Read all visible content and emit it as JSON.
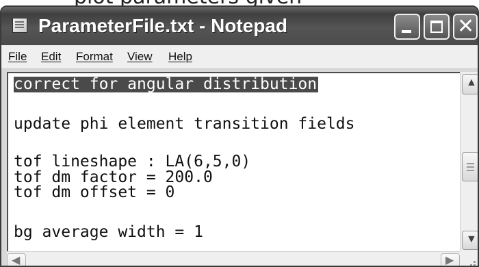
{
  "window": {
    "title": "ParameterFile.txt - Notepad",
    "caption_top_fragment": "plot parameters given"
  },
  "menu": {
    "file": "File",
    "edit": "Edit",
    "format": "Format",
    "view": "View",
    "help": "Help"
  },
  "editor": {
    "lines": [
      "correct for angular distribution",
      "update phi element transition fields",
      "tof lineshape : LA(6,5,0)",
      "tof dm factor = 200.0",
      "tof dm offset = 0",
      "bg average width = 1"
    ],
    "selected_line_index": 0
  },
  "scrollbars": {
    "up_glyph": "▲",
    "down_glyph": "▼",
    "left_glyph": "◀",
    "right_glyph": "▶"
  },
  "window_buttons": {
    "close_glyph": "✕"
  },
  "icons": {
    "app": "notepad-icon",
    "minimize": "minimize-icon",
    "maximize": "maximize-icon",
    "close": "close-icon",
    "thumb_grip": "grip-icon",
    "size_grip": "size-grip-icon"
  },
  "colors": {
    "selection_bg": "#4a4a4a",
    "titlebar_bg": "#4a4a4a",
    "editor_bg": "#ffffff"
  }
}
